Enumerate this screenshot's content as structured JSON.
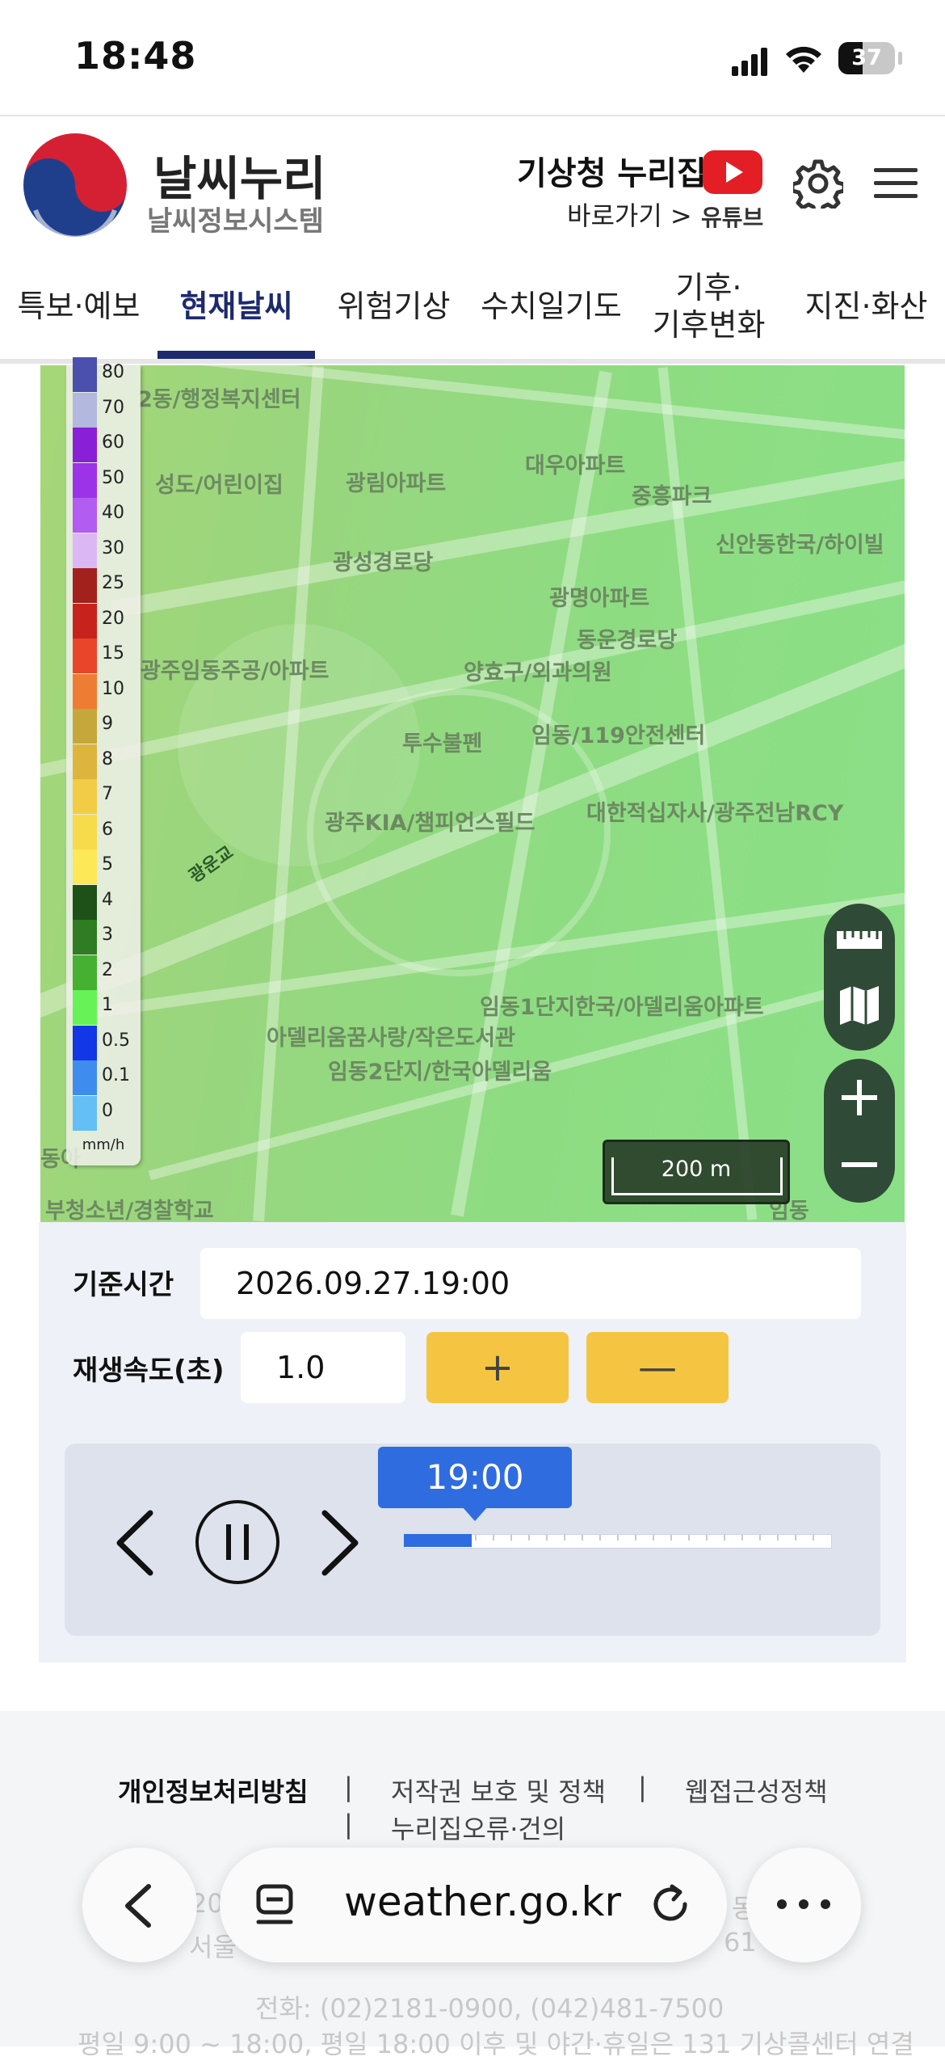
{
  "status_bar": {
    "time": "18:48",
    "battery": "37"
  },
  "header": {
    "logo_title": "날씨누리",
    "logo_subtitle": "날씨정보시스템",
    "hq_title": "기상청 누리집",
    "hq_link": "바로가기 >",
    "youtube_label": "유튜브",
    "icons": [
      "youtube-icon",
      "gear-icon",
      "hamburger-menu-icon"
    ]
  },
  "nav": {
    "tabs": [
      {
        "label": "특보·예보",
        "active": false
      },
      {
        "label": "현재날씨",
        "active": true
      },
      {
        "label": "위험기상",
        "active": false
      },
      {
        "label": "수치일기도",
        "active": false
      },
      {
        "label": "기후·\n기후변화",
        "active": false
      },
      {
        "label": "지진·화산",
        "active": false
      }
    ],
    "active_color": "#1d2a6e"
  },
  "map": {
    "labels": [
      "2동/행정복지센터",
      "성도/어린이집",
      "광림아파트",
      "대우아파트",
      "중흥파크",
      "신안동한국/하이빌",
      "광성경로당",
      "광명아파트",
      "동운경로당",
      "광주임동주공/아파트",
      "양효구/외과의원",
      "투수불펜",
      "임동/119안전센터",
      "광주KIA/챔피언스필드",
      "대한적십자사/광주전남RCY",
      "광운교",
      "임동1단지한국/아델리움아파트",
      "아델리움꿈사랑/작은도서관",
      "임동2단지/한국아델리움",
      "부청소년/경찰학교",
      "임동",
      "동아"
    ],
    "legend": {
      "unit": "mm/h",
      "items": [
        {
          "value": "80",
          "color": "#4b4fae"
        },
        {
          "value": "70",
          "color": "#b3b8de"
        },
        {
          "value": "60",
          "color": "#8a1fd8"
        },
        {
          "value": "50",
          "color": "#9d33e9"
        },
        {
          "value": "40",
          "color": "#b25cf2"
        },
        {
          "value": "30",
          "color": "#dbb8f3"
        },
        {
          "value": "25",
          "color": "#a3211d"
        },
        {
          "value": "20",
          "color": "#c8221c"
        },
        {
          "value": "15",
          "color": "#e9452a"
        },
        {
          "value": "10",
          "color": "#ef7c33"
        },
        {
          "value": "9",
          "color": "#c6a73b"
        },
        {
          "value": "8",
          "color": "#ddb53d"
        },
        {
          "value": "7",
          "color": "#f3cc45"
        },
        {
          "value": "6",
          "color": "#f7db4a"
        },
        {
          "value": "5",
          "color": "#fde858"
        },
        {
          "value": "4",
          "color": "#1e5118"
        },
        {
          "value": "3",
          "color": "#2f7c22"
        },
        {
          "value": "2",
          "color": "#46b032"
        },
        {
          "value": "1",
          "color": "#67f257"
        },
        {
          "value": "0.5",
          "color": "#1237e6"
        },
        {
          "value": "0.1",
          "color": "#3f8cef"
        },
        {
          "value": "0",
          "color": "#63bff6"
        }
      ]
    },
    "scale": "200 m",
    "controls": [
      "ruler-icon",
      "map-layers-icon",
      "zoom-in-icon",
      "zoom-out-icon"
    ]
  },
  "controls": {
    "base_time_label": "기준시간",
    "base_time_value": "2026.09.27.19:00",
    "speed_label": "재생속도(초)",
    "speed_value": "1.0",
    "plus_label": "+",
    "minus_label": "—",
    "current_time": "19:00",
    "progress": 0.16
  },
  "footer": {
    "privacy": "개인정보처리방침",
    "copyright": "저작권 보호 및 정책",
    "accessibility": "웹접근성정책",
    "report": "누리집오류·건의",
    "sep": "|",
    "phone": "전화: (02)2181-0900, (042)481-7500",
    "hours": "평일 9:00 ~ 18:00, 평일 18:00 이후 및 야간·휴일은 131 기상콜센터 연결",
    "addr_fragment_1": "서울",
    "addr_fragment_2": "61",
    "year_fragment": "20",
    "dong_fragment": "동"
  },
  "browser": {
    "url": "weather.go.kr"
  }
}
